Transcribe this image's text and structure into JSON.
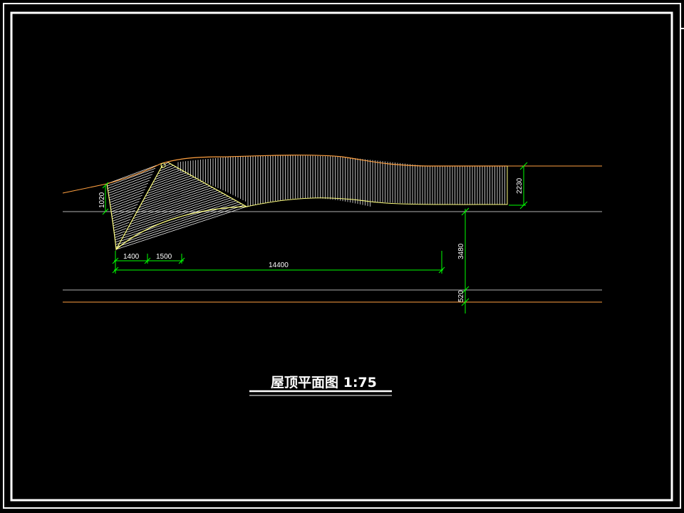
{
  "drawing": {
    "title": "屋顶平面图 1:75",
    "colors": {
      "background": "#000000",
      "border": "#ffffff",
      "dimension": "#00ff00",
      "outline": "#ffa040",
      "roof_edge": "#ffff80",
      "hatch": "#e8e8e8",
      "guide_line": "#b0b0b0",
      "text": "#ffffff"
    },
    "dimensions": {
      "d_1020": "1020",
      "d_2230": "2230",
      "d_3480": "3480",
      "d_520": "520",
      "d_1400": "1400",
      "d_1500": "1500",
      "d_14400": "14400"
    }
  }
}
